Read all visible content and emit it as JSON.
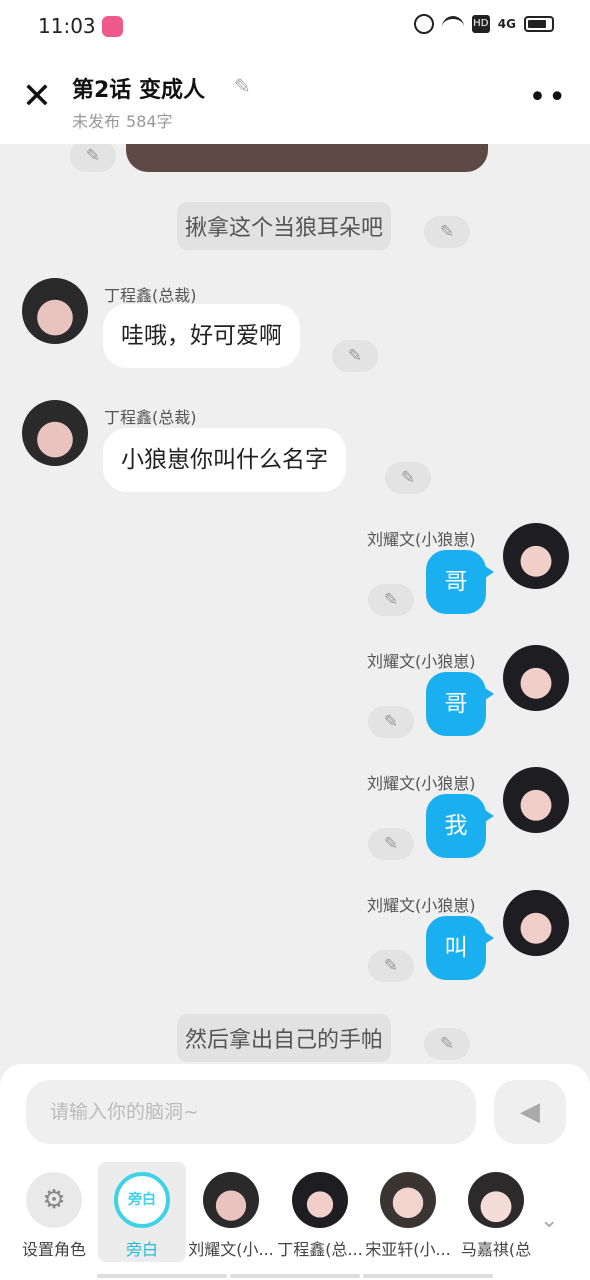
{
  "status_bar": {
    "time": "11:03",
    "hd": "HD",
    "signal": "4G"
  },
  "header": {
    "title": "第2话  变成人",
    "status": "未发布",
    "word_count": "584字"
  },
  "chat": {
    "narration_top": "揪拿这个当狼耳朵吧",
    "messages": [
      {
        "side": "left",
        "name": "丁程鑫(总裁)",
        "text": "哇哦，好可爱啊"
      },
      {
        "side": "left",
        "name": "丁程鑫(总裁)",
        "text": "小狼崽你叫什么名字"
      },
      {
        "side": "right",
        "name": "刘耀文(小狼崽)",
        "text": "哥"
      },
      {
        "side": "right",
        "name": "刘耀文(小狼崽)",
        "text": "哥"
      },
      {
        "side": "right",
        "name": "刘耀文(小狼崽)",
        "text": "我"
      },
      {
        "side": "right",
        "name": "刘耀文(小狼崽)",
        "text": "叫"
      }
    ],
    "narration_bottom": "然后拿出自己的手帕"
  },
  "composer": {
    "placeholder": "请输入你的脑洞~"
  },
  "roles": {
    "settings_label": "设置角色",
    "narrator_icon_text": "旁白",
    "narrator_label": "旁白",
    "items": [
      {
        "label": "刘耀文(小..."
      },
      {
        "label": "丁程鑫(总..."
      },
      {
        "label": "宋亚轩(小..."
      },
      {
        "label": "马嘉祺(总"
      }
    ]
  }
}
